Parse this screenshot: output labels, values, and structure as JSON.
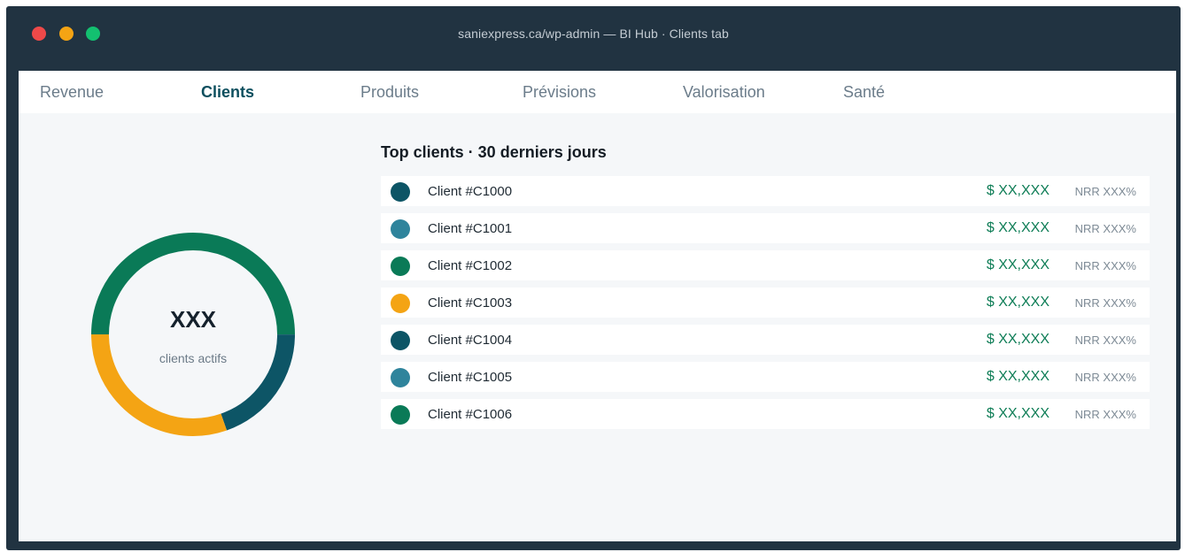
{
  "window": {
    "title": "saniexpress.ca/wp-admin — BI Hub · Clients tab",
    "controls": [
      "close",
      "minimize",
      "maximize"
    ]
  },
  "tabs": [
    {
      "label": "Revenue",
      "active": false
    },
    {
      "label": "Clients",
      "active": true
    },
    {
      "label": "Produits",
      "active": false
    },
    {
      "label": "Prévisions",
      "active": false
    },
    {
      "label": "Valorisation",
      "active": false
    },
    {
      "label": "Santé",
      "active": false
    }
  ],
  "donut": {
    "value": "XXX",
    "label": "clients actifs",
    "segments": [
      {
        "color": "#0a7a57",
        "fraction": 0.5
      },
      {
        "color": "#0d5566",
        "fraction": 0.196
      },
      {
        "color": "#f4a414",
        "fraction": 0.304
      }
    ]
  },
  "panel": {
    "title": "Top clients · 30 derniers jours",
    "rows": [
      {
        "name": "Client #C1000",
        "amount": "$ XX,XXX",
        "nrr": "NRR XXX%",
        "color": "#0d5566"
      },
      {
        "name": "Client #C1001",
        "amount": "$ XX,XXX",
        "nrr": "NRR XXX%",
        "color": "#2f849c"
      },
      {
        "name": "Client #C1002",
        "amount": "$ XX,XXX",
        "nrr": "NRR XXX%",
        "color": "#0a7a57"
      },
      {
        "name": "Client #C1003",
        "amount": "$ XX,XXX",
        "nrr": "NRR XXX%",
        "color": "#f4a414"
      },
      {
        "name": "Client #C1004",
        "amount": "$ XX,XXX",
        "nrr": "NRR XXX%",
        "color": "#0d5566"
      },
      {
        "name": "Client #C1005",
        "amount": "$ XX,XXX",
        "nrr": "NRR XXX%",
        "color": "#2f849c"
      },
      {
        "name": "Client #C1006",
        "amount": "$ XX,XXX",
        "nrr": "NRR XXX%",
        "color": "#0a7a57"
      }
    ]
  }
}
